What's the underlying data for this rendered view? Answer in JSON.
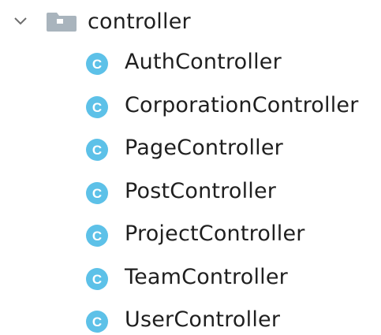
{
  "tree": {
    "folder": {
      "label": "controller",
      "expanded": true,
      "icon": "folder-icon",
      "chevron_icon": "chevron-down-icon"
    },
    "items": [
      {
        "label": "AuthController",
        "icon": "class-icon"
      },
      {
        "label": "CorporationController",
        "icon": "class-icon"
      },
      {
        "label": "PageController",
        "icon": "class-icon"
      },
      {
        "label": "PostController",
        "icon": "class-icon"
      },
      {
        "label": "ProjectController",
        "icon": "class-icon"
      },
      {
        "label": "TeamController",
        "icon": "class-icon"
      },
      {
        "label": "UserController",
        "icon": "class-icon"
      }
    ],
    "class_icon_letter": "C"
  },
  "colors": {
    "class_icon_fill": "#5dc1e8",
    "class_icon_letter": "#ffffff",
    "folder_fill": "#a9b4bd",
    "chevron": "#6e6e6e",
    "text": "#1f1f1f"
  }
}
